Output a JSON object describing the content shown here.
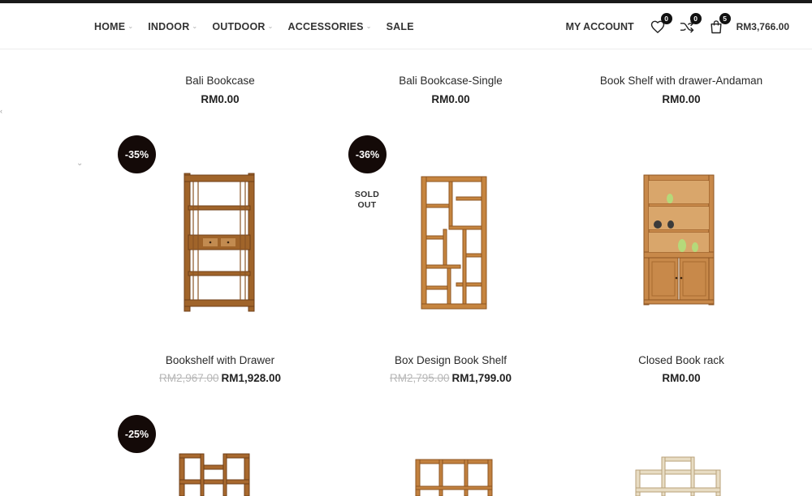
{
  "nav": {
    "items": [
      {
        "label": "HOME",
        "has_dropdown": true
      },
      {
        "label": "INDOOR",
        "has_dropdown": true
      },
      {
        "label": "OUTDOOR",
        "has_dropdown": true
      },
      {
        "label": "ACCESSORIES",
        "has_dropdown": true
      },
      {
        "label": "SALE",
        "has_dropdown": false
      }
    ],
    "chevron": "⌄"
  },
  "header": {
    "account_label": "MY ACCOUNT",
    "wishlist_count": "0",
    "compare_count": "0",
    "cart_count": "5",
    "cart_total": "RM3,766.00"
  },
  "products_row1": [
    {
      "title": "Bali Bookcase",
      "price": "RM0.00"
    },
    {
      "title": "Bali Bookcase-Single",
      "price": "RM0.00"
    },
    {
      "title": "Book Shelf with drawer-Andaman",
      "price": "RM0.00"
    }
  ],
  "products_row2": [
    {
      "title": "Bookshelf with Drawer",
      "old_price": "RM2,967.00",
      "price": "RM1,928.00",
      "discount": "-35%"
    },
    {
      "title": "Box Design Book Shelf",
      "old_price": "RM2,795.00",
      "price": "RM1,799.00",
      "discount": "-36%",
      "sold_out_line1": "SOLD",
      "sold_out_line2": "OUT"
    },
    {
      "title": "Closed Book rack",
      "price": "RM0.00"
    }
  ],
  "products_row3": [
    {
      "discount": "-25%"
    }
  ],
  "colors": {
    "wood": "#a0642a",
    "wood_dark": "#6f3f18",
    "badge": "#140a08",
    "nav_text": "#333333"
  },
  "side": {
    "mark": "‹",
    "chevron": "⌄"
  }
}
